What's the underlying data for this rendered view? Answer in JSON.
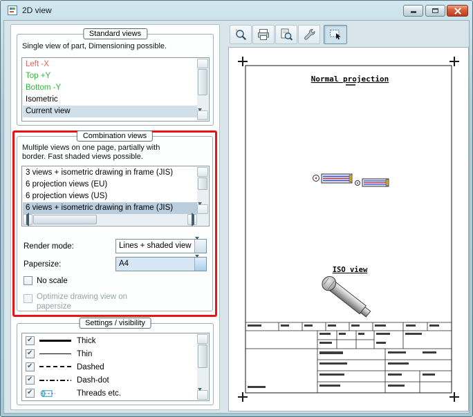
{
  "window": {
    "title": "2D view"
  },
  "titlebar_controls": {
    "minimize": "minimize",
    "maximize": "maximize",
    "close": "close"
  },
  "toolbar": {
    "icons": [
      "zoom",
      "print",
      "print-preview",
      "tools",
      "capture"
    ],
    "active_icon": "capture"
  },
  "standard_views": {
    "title": "Standard views",
    "description": "Single view of part, Dimensioning possible.",
    "items": [
      {
        "label": "Left -X",
        "color": "#e0635c",
        "selected": false
      },
      {
        "label": "Top +Y",
        "color": "#2db83d",
        "selected": false
      },
      {
        "label": "Bottom -Y",
        "color": "#2db83d",
        "selected": false
      },
      {
        "label": "Isometric",
        "color": "#000000",
        "selected": false
      },
      {
        "label": "Current view",
        "color": "#000000",
        "selected": true
      }
    ]
  },
  "combination_views": {
    "title": "Combination views",
    "description": "Multiple views on one page, partially with border. Fast shaded views possible.",
    "items": [
      {
        "label": "3 views + isometric drawing in frame (JIS)",
        "selected": false
      },
      {
        "label": "6 projection views (EU)",
        "selected": false
      },
      {
        "label": "6 projection views (US)",
        "selected": false
      },
      {
        "label": "6 views + isometric drawing in frame (JIS)",
        "selected": true
      }
    ],
    "render_mode": {
      "label": "Render mode:",
      "value": "Lines + shaded view"
    },
    "papersize": {
      "label": "Papersize:",
      "value": "A4"
    },
    "no_scale": {
      "label": "No scale",
      "checked": false
    },
    "optimize": {
      "label": "Optimize drawing view on papersize",
      "checked": false,
      "enabled": false
    }
  },
  "settings_visibility": {
    "title": "Settings / visibility",
    "items": [
      {
        "label": "Thick",
        "checked": true,
        "sample": "thick-line"
      },
      {
        "label": "Thin",
        "checked": true,
        "sample": "thin-line"
      },
      {
        "label": "Dashed",
        "checked": true,
        "sample": "dashed-line"
      },
      {
        "label": "Dash-dot",
        "checked": true,
        "sample": "dash-dot-line"
      },
      {
        "label": "Threads etc.",
        "checked": true,
        "sample": "threads-icon"
      }
    ]
  },
  "drawing": {
    "normal_projection_label": "Normal projection",
    "iso_view_label": "ISO view"
  },
  "colors": {
    "highlight_border": "#e81414",
    "selection_bg": "#b9cddd",
    "selection_bg_light": "#cfe0eb"
  }
}
